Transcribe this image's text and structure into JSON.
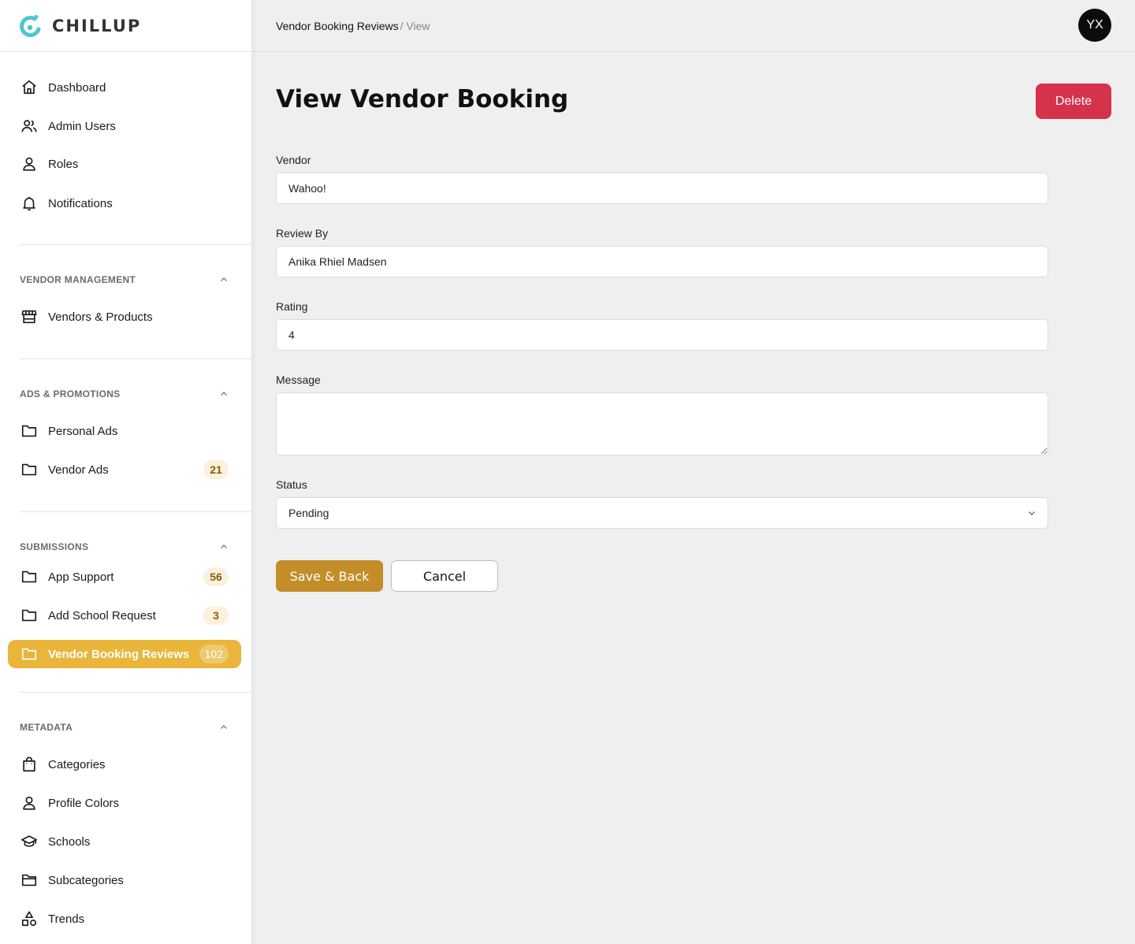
{
  "app": {
    "brand": "CHILLUP",
    "accent": "#e9b53a",
    "danger": "#d5334b",
    "primary_button": "#c38d29"
  },
  "header": {
    "breadcrumb_parent": "Vendor Booking Reviews",
    "breadcrumb_current": "/ View",
    "avatar_initials": "YX"
  },
  "sidebar": {
    "main": [
      {
        "label": "Dashboard",
        "icon": "home-icon"
      },
      {
        "label": "Admin Users",
        "icon": "users-icon"
      },
      {
        "label": "Roles",
        "icon": "user-icon"
      },
      {
        "label": "Notifications",
        "icon": "bell-icon"
      }
    ],
    "vendor_management": {
      "title": "VENDOR MANAGEMENT",
      "items": [
        {
          "label": "Vendors & Products",
          "icon": "store-icon"
        }
      ]
    },
    "ads_promotions": {
      "title": "ADS & PROMOTIONS",
      "items": [
        {
          "label": "Personal Ads",
          "icon": "folder-icon"
        },
        {
          "label": "Vendor Ads",
          "icon": "folder-icon",
          "badge": "21"
        }
      ]
    },
    "submissions": {
      "title": "SUBMISSIONS",
      "items": [
        {
          "label": "App Support",
          "icon": "folder-icon",
          "badge": "56"
        },
        {
          "label": "Add School Request",
          "icon": "folder-icon",
          "badge": "3"
        },
        {
          "label": "Vendor Booking Reviews",
          "icon": "folder-icon",
          "badge": "102",
          "active": true
        }
      ]
    },
    "metadata": {
      "title": "METADATA",
      "items": [
        {
          "label": "Categories",
          "icon": "shopping-bag-icon"
        },
        {
          "label": "Profile Colors",
          "icon": "user-icon"
        },
        {
          "label": "Schools",
          "icon": "graduation-cap-icon"
        },
        {
          "label": "Subcategories",
          "icon": "folder-icon"
        },
        {
          "label": "Trends",
          "icon": "shapes-icon"
        }
      ]
    }
  },
  "main": {
    "title": "View Vendor Booking",
    "delete_label": "Delete",
    "form": {
      "vendor": {
        "label": "Vendor",
        "value": "Wahoo!"
      },
      "review_by": {
        "label": "Review By",
        "value": "Anika Rhiel Madsen"
      },
      "rating": {
        "label": "Rating",
        "value": "4"
      },
      "message": {
        "label": "Message",
        "value": ""
      },
      "status": {
        "label": "Status",
        "value": "Pending"
      }
    },
    "save_label": "Save & Back",
    "cancel_label": "Cancel"
  }
}
